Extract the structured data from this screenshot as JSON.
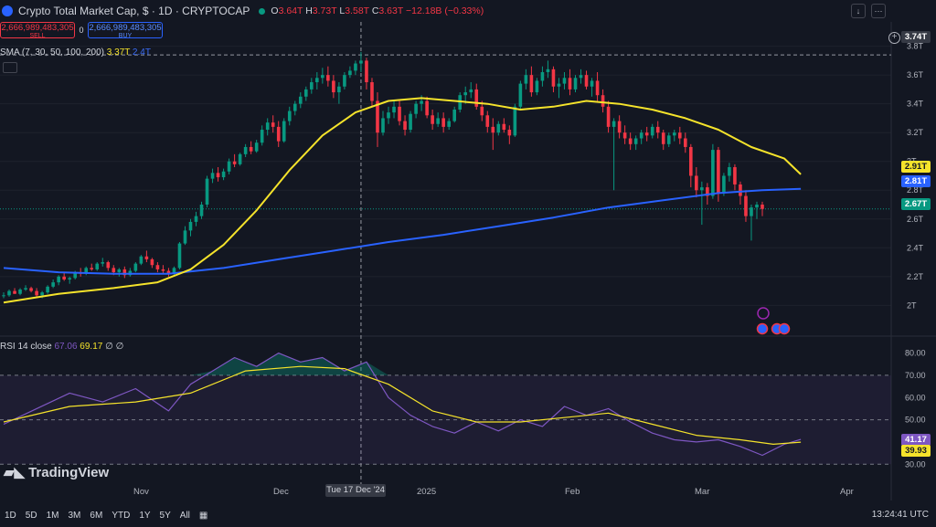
{
  "header": {
    "title": "Crypto Total Market Cap, $ · 1D · CRYPTOCAP",
    "ohlc": {
      "o_label": "O",
      "o": "3.64T",
      "h_label": "H",
      "h": "3.73T",
      "l_label": "L",
      "l": "3.58T",
      "c_label": "C",
      "c": "3.63T",
      "change": "−12.18B (−0.33%)"
    }
  },
  "trade": {
    "sell_value": "2,666,989,483,305",
    "sell_label": "SELL",
    "spread": "0",
    "buy_value": "2,666,989,483,305",
    "buy_label": "BUY"
  },
  "sma_legend": {
    "label": "SMA (7, 30, 50, 100, 200)",
    "v1": "3.37T",
    "v2": "2.4T"
  },
  "rsi_legend": {
    "label": "RSI 14 close",
    "v1": "67.06",
    "v2": "69.17",
    "v3": "∅ ∅"
  },
  "price_tags": {
    "crosshair": "3.74T",
    "sma_yellow": "2.91T",
    "sma_blue": "2.81T",
    "last": "2.67T",
    "rsi": "41.17",
    "rsi_ma": "39.93"
  },
  "x_axis": {
    "labels": [
      "Nov",
      "Dec",
      "2025",
      "Feb",
      "Mar",
      "Apr"
    ],
    "crosshair": "Tue 17 Dec '24"
  },
  "timeframes": [
    "1D",
    "5D",
    "1M",
    "3M",
    "6M",
    "YTD",
    "1Y",
    "5Y",
    "All"
  ],
  "clock": "13:24:41 UTC",
  "logo_text": "TradingView",
  "colors": {
    "up": "#089981",
    "down": "#f23645",
    "sma_yellow": "#f5e32b",
    "sma_blue": "#2962ff",
    "rsi": "#7e57c2",
    "rsi_ma": "#f5e32b",
    "background": "#131722"
  },
  "chart_data": {
    "type": "candlestick",
    "unit": "T",
    "y_ticks": [
      2.0,
      2.2,
      2.4,
      2.6,
      2.8,
      3.0,
      3.2,
      3.4,
      3.6,
      3.8
    ],
    "y_tick_labels": [
      "2T",
      "2.2T",
      "2.4T",
      "2.6T",
      "2.8T",
      "3T",
      "3.2T",
      "3.4T",
      "3.6T",
      "3.8T"
    ],
    "ylim": [
      1.85,
      3.88
    ],
    "candles": [
      [
        2.07,
        2.09,
        2.05,
        2.07
      ],
      [
        2.07,
        2.11,
        2.06,
        2.1
      ],
      [
        2.1,
        2.12,
        2.08,
        2.08
      ],
      [
        2.08,
        2.12,
        2.07,
        2.11
      ],
      [
        2.11,
        2.14,
        2.1,
        2.12
      ],
      [
        2.12,
        2.13,
        2.09,
        2.1
      ],
      [
        2.1,
        2.12,
        2.06,
        2.07
      ],
      [
        2.07,
        2.1,
        2.05,
        2.09
      ],
      [
        2.09,
        2.14,
        2.08,
        2.13
      ],
      [
        2.13,
        2.18,
        2.12,
        2.16
      ],
      [
        2.16,
        2.21,
        2.14,
        2.2
      ],
      [
        2.2,
        2.23,
        2.17,
        2.18
      ],
      [
        2.18,
        2.2,
        2.15,
        2.19
      ],
      [
        2.19,
        2.24,
        2.18,
        2.23
      ],
      [
        2.23,
        2.26,
        2.2,
        2.22
      ],
      [
        2.22,
        2.27,
        2.21,
        2.26
      ],
      [
        2.26,
        2.29,
        2.24,
        2.25
      ],
      [
        2.25,
        2.3,
        2.24,
        2.29
      ],
      [
        2.29,
        2.33,
        2.27,
        2.3
      ],
      [
        2.3,
        2.31,
        2.24,
        2.26
      ],
      [
        2.26,
        2.28,
        2.21,
        2.23
      ],
      [
        2.23,
        2.26,
        2.2,
        2.25
      ],
      [
        2.25,
        2.27,
        2.19,
        2.21
      ],
      [
        2.21,
        2.26,
        2.2,
        2.24
      ],
      [
        2.24,
        2.3,
        2.23,
        2.29
      ],
      [
        2.29,
        2.35,
        2.28,
        2.34
      ],
      [
        2.34,
        2.38,
        2.3,
        2.32
      ],
      [
        2.32,
        2.33,
        2.26,
        2.28
      ],
      [
        2.28,
        2.3,
        2.23,
        2.25
      ],
      [
        2.25,
        2.28,
        2.22,
        2.24
      ],
      [
        2.24,
        2.26,
        2.2,
        2.22
      ],
      [
        2.22,
        2.27,
        2.21,
        2.26
      ],
      [
        2.26,
        2.44,
        2.25,
        2.43
      ],
      [
        2.43,
        2.55,
        2.42,
        2.52
      ],
      [
        2.52,
        2.6,
        2.48,
        2.58
      ],
      [
        2.58,
        2.65,
        2.55,
        2.62
      ],
      [
        2.62,
        2.72,
        2.6,
        2.7
      ],
      [
        2.7,
        2.9,
        2.68,
        2.88
      ],
      [
        2.88,
        2.95,
        2.85,
        2.92
      ],
      [
        2.92,
        2.96,
        2.86,
        2.89
      ],
      [
        2.89,
        2.95,
        2.87,
        2.93
      ],
      [
        2.93,
        3.02,
        2.91,
        3.0
      ],
      [
        3.0,
        3.05,
        2.96,
        2.98
      ],
      [
        2.98,
        3.06,
        2.97,
        3.05
      ],
      [
        3.05,
        3.12,
        3.03,
        3.1
      ],
      [
        3.1,
        3.14,
        3.05,
        3.07
      ],
      [
        3.07,
        3.15,
        3.06,
        3.13
      ],
      [
        3.13,
        3.25,
        3.11,
        3.22
      ],
      [
        3.22,
        3.3,
        3.18,
        3.27
      ],
      [
        3.27,
        3.32,
        3.2,
        3.24
      ],
      [
        3.24,
        3.28,
        3.1,
        3.14
      ],
      [
        3.14,
        3.3,
        3.13,
        3.28
      ],
      [
        3.28,
        3.38,
        3.25,
        3.35
      ],
      [
        3.35,
        3.42,
        3.32,
        3.4
      ],
      [
        3.4,
        3.48,
        3.37,
        3.45
      ],
      [
        3.45,
        3.52,
        3.42,
        3.5
      ],
      [
        3.5,
        3.58,
        3.47,
        3.55
      ],
      [
        3.55,
        3.62,
        3.5,
        3.58
      ],
      [
        3.58,
        3.65,
        3.54,
        3.6
      ],
      [
        3.6,
        3.66,
        3.52,
        3.56
      ],
      [
        3.56,
        3.6,
        3.44,
        3.48
      ],
      [
        3.48,
        3.55,
        3.4,
        3.52
      ],
      [
        3.52,
        3.62,
        3.5,
        3.6
      ],
      [
        3.6,
        3.66,
        3.58,
        3.63
      ],
      [
        3.63,
        3.7,
        3.6,
        3.68
      ],
      [
        3.68,
        3.76,
        3.62,
        3.7
      ],
      [
        3.7,
        3.72,
        3.5,
        3.55
      ],
      [
        3.55,
        3.58,
        3.38,
        3.42
      ],
      [
        3.42,
        3.48,
        3.1,
        3.2
      ],
      [
        3.2,
        3.35,
        3.18,
        3.3
      ],
      [
        3.3,
        3.38,
        3.26,
        3.34
      ],
      [
        3.34,
        3.42,
        3.3,
        3.38
      ],
      [
        3.38,
        3.42,
        3.25,
        3.28
      ],
      [
        3.28,
        3.32,
        3.18,
        3.22
      ],
      [
        3.22,
        3.35,
        3.2,
        3.33
      ],
      [
        3.33,
        3.42,
        3.3,
        3.4
      ],
      [
        3.4,
        3.46,
        3.35,
        3.42
      ],
      [
        3.42,
        3.45,
        3.3,
        3.32
      ],
      [
        3.32,
        3.36,
        3.22,
        3.26
      ],
      [
        3.26,
        3.34,
        3.24,
        3.3
      ],
      [
        3.3,
        3.34,
        3.2,
        3.24
      ],
      [
        3.24,
        3.3,
        3.22,
        3.28
      ],
      [
        3.28,
        3.38,
        3.27,
        3.36
      ],
      [
        3.36,
        3.48,
        3.34,
        3.46
      ],
      [
        3.46,
        3.52,
        3.4,
        3.48
      ],
      [
        3.48,
        3.55,
        3.44,
        3.5
      ],
      [
        3.5,
        3.54,
        3.36,
        3.38
      ],
      [
        3.38,
        3.42,
        3.28,
        3.32
      ],
      [
        3.32,
        3.35,
        3.2,
        3.24
      ],
      [
        3.24,
        3.3,
        3.08,
        3.2
      ],
      [
        3.2,
        3.28,
        3.18,
        3.26
      ],
      [
        3.26,
        3.3,
        3.2,
        3.22
      ],
      [
        3.22,
        3.25,
        3.12,
        3.18
      ],
      [
        3.18,
        3.4,
        3.17,
        3.38
      ],
      [
        3.38,
        3.56,
        3.36,
        3.54
      ],
      [
        3.54,
        3.64,
        3.5,
        3.6
      ],
      [
        3.6,
        3.66,
        3.45,
        3.48
      ],
      [
        3.48,
        3.58,
        3.46,
        3.56
      ],
      [
        3.56,
        3.66,
        3.52,
        3.62
      ],
      [
        3.62,
        3.7,
        3.58,
        3.64
      ],
      [
        3.64,
        3.66,
        3.48,
        3.52
      ],
      [
        3.52,
        3.58,
        3.44,
        3.54
      ],
      [
        3.54,
        3.62,
        3.5,
        3.58
      ],
      [
        3.58,
        3.64,
        3.46,
        3.5
      ],
      [
        3.5,
        3.6,
        3.48,
        3.58
      ],
      [
        3.58,
        3.64,
        3.54,
        3.6
      ],
      [
        3.6,
        3.63,
        3.5,
        3.52
      ],
      [
        3.52,
        3.58,
        3.45,
        3.56
      ],
      [
        3.56,
        3.62,
        3.42,
        3.46
      ],
      [
        3.46,
        3.5,
        3.34,
        3.38
      ],
      [
        3.38,
        3.42,
        3.2,
        3.24
      ],
      [
        3.24,
        3.3,
        2.8,
        3.28
      ],
      [
        3.28,
        3.32,
        3.16,
        3.2
      ],
      [
        3.2,
        3.25,
        3.12,
        3.16
      ],
      [
        3.16,
        3.2,
        3.08,
        3.12
      ],
      [
        3.12,
        3.18,
        3.08,
        3.16
      ],
      [
        3.16,
        3.22,
        3.12,
        3.2
      ],
      [
        3.2,
        3.24,
        3.14,
        3.18
      ],
      [
        3.18,
        3.26,
        3.16,
        3.24
      ],
      [
        3.24,
        3.28,
        3.16,
        3.2
      ],
      [
        3.2,
        3.22,
        3.08,
        3.12
      ],
      [
        3.12,
        3.2,
        3.1,
        3.18
      ],
      [
        3.18,
        3.22,
        3.14,
        3.2
      ],
      [
        3.2,
        3.24,
        3.12,
        3.16
      ],
      [
        3.16,
        3.2,
        3.06,
        3.1
      ],
      [
        3.1,
        3.12,
        2.82,
        2.9
      ],
      [
        2.9,
        2.96,
        2.75,
        2.8
      ],
      [
        2.8,
        2.86,
        2.56,
        2.82
      ],
      [
        2.82,
        2.85,
        2.7,
        2.76
      ],
      [
        2.76,
        3.12,
        2.74,
        3.08
      ],
      [
        3.08,
        3.1,
        2.72,
        2.78
      ],
      [
        2.78,
        2.92,
        2.76,
        2.9
      ],
      [
        2.9,
        2.99,
        2.86,
        2.96
      ],
      [
        2.96,
        2.98,
        2.8,
        2.84
      ],
      [
        2.84,
        2.86,
        2.7,
        2.76
      ],
      [
        2.76,
        2.8,
        2.58,
        2.62
      ],
      [
        2.62,
        2.7,
        2.45,
        2.68
      ],
      [
        2.68,
        2.72,
        2.6,
        2.7
      ],
      [
        2.7,
        2.72,
        2.62,
        2.67
      ]
    ],
    "sma_yellow_points": [
      [
        0,
        2.02
      ],
      [
        10,
        2.08
      ],
      [
        20,
        2.12
      ],
      [
        28,
        2.16
      ],
      [
        34,
        2.25
      ],
      [
        40,
        2.42
      ],
      [
        46,
        2.66
      ],
      [
        52,
        2.94
      ],
      [
        58,
        3.18
      ],
      [
        64,
        3.34
      ],
      [
        70,
        3.42
      ],
      [
        76,
        3.44
      ],
      [
        82,
        3.42
      ],
      [
        88,
        3.4
      ],
      [
        94,
        3.36
      ],
      [
        100,
        3.38
      ],
      [
        106,
        3.42
      ],
      [
        112,
        3.4
      ],
      [
        118,
        3.36
      ],
      [
        124,
        3.3
      ],
      [
        130,
        3.22
      ],
      [
        136,
        3.1
      ],
      [
        142,
        3.02
      ],
      [
        145,
        2.91
      ]
    ],
    "sma_blue_points": [
      [
        0,
        2.26
      ],
      [
        10,
        2.23
      ],
      [
        20,
        2.22
      ],
      [
        30,
        2.22
      ],
      [
        40,
        2.26
      ],
      [
        50,
        2.32
      ],
      [
        60,
        2.38
      ],
      [
        70,
        2.44
      ],
      [
        80,
        2.49
      ],
      [
        90,
        2.55
      ],
      [
        100,
        2.61
      ],
      [
        110,
        2.68
      ],
      [
        120,
        2.73
      ],
      [
        130,
        2.78
      ],
      [
        138,
        2.8
      ],
      [
        145,
        2.81
      ]
    ],
    "rsi": {
      "levels": [
        30,
        50,
        70
      ],
      "y_ticks": [
        30,
        40,
        50,
        60,
        70,
        80
      ],
      "y_tick_labels": [
        "30.00",
        "40.00",
        "50.00",
        "60.00",
        "70.00",
        "80.00"
      ],
      "ylim": [
        26,
        86
      ],
      "rsi_points": [
        [
          0,
          48
        ],
        [
          6,
          55
        ],
        [
          12,
          62
        ],
        [
          18,
          58
        ],
        [
          24,
          64
        ],
        [
          30,
          54
        ],
        [
          34,
          66
        ],
        [
          38,
          72
        ],
        [
          42,
          78
        ],
        [
          46,
          74
        ],
        [
          50,
          80
        ],
        [
          54,
          76
        ],
        [
          58,
          78
        ],
        [
          62,
          72
        ],
        [
          66,
          76
        ],
        [
          70,
          60
        ],
        [
          74,
          52
        ],
        [
          78,
          47
        ],
        [
          82,
          44
        ],
        [
          86,
          49
        ],
        [
          90,
          45
        ],
        [
          94,
          50
        ],
        [
          98,
          47
        ],
        [
          102,
          56
        ],
        [
          106,
          52
        ],
        [
          110,
          55
        ],
        [
          114,
          49
        ],
        [
          118,
          44
        ],
        [
          122,
          41
        ],
        [
          126,
          40
        ],
        [
          130,
          41
        ],
        [
          134,
          38
        ],
        [
          138,
          34
        ],
        [
          142,
          39
        ],
        [
          145,
          41.17
        ]
      ],
      "rsi_ma_points": [
        [
          0,
          49
        ],
        [
          12,
          56
        ],
        [
          24,
          58
        ],
        [
          34,
          62
        ],
        [
          44,
          72
        ],
        [
          54,
          74
        ],
        [
          62,
          73
        ],
        [
          70,
          66
        ],
        [
          78,
          54
        ],
        [
          86,
          49
        ],
        [
          94,
          49
        ],
        [
          102,
          51
        ],
        [
          110,
          53
        ],
        [
          118,
          48
        ],
        [
          126,
          43
        ],
        [
          134,
          41
        ],
        [
          140,
          39
        ],
        [
          145,
          39.93
        ]
      ]
    }
  }
}
